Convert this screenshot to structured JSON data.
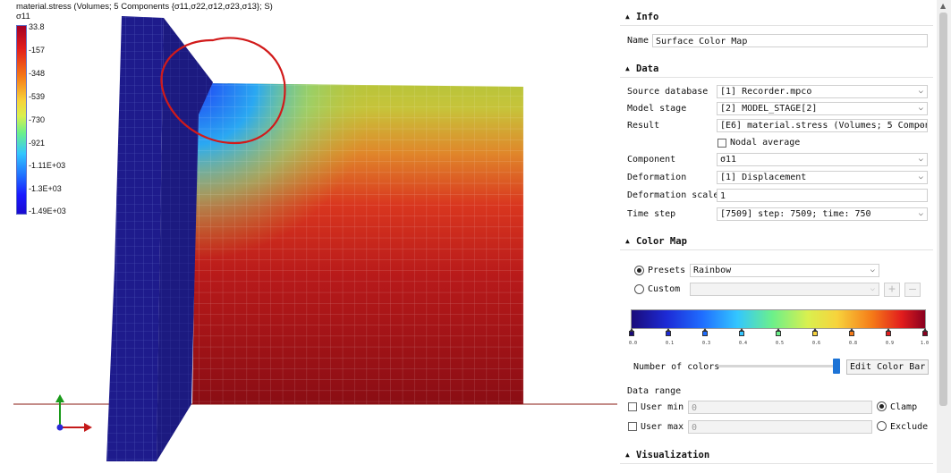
{
  "viewport": {
    "legend_title": "material.stress (Volumes; 5 Components {σ11,σ22,σ12,σ23,σ13}; S)",
    "legend_component": "σ11",
    "legend_ticks": [
      "33.8",
      "-157",
      "-348",
      "-539",
      "-730",
      "-921",
      "-1.11E+03",
      "-1.3E+03",
      "-1.49E+03"
    ]
  },
  "panel": {
    "info": {
      "header": "Info",
      "name_label": "Name",
      "name_value": "Surface Color Map"
    },
    "data": {
      "header": "Data",
      "source_database_label": "Source database",
      "source_database_value": "[1] Recorder.mpco",
      "model_stage_label": "Model stage",
      "model_stage_value": "[2] MODEL_STAGE[2]",
      "result_label": "Result",
      "result_value": "[E6] material.stress (Volumes; 5 Compon",
      "nodal_average_label": "Nodal average",
      "nodal_average_checked": false,
      "component_label": "Component",
      "component_value": "σ11",
      "deformation_label": "Deformation",
      "deformation_value": "[1] Displacement",
      "deformation_scale_label": "Deformation scale",
      "deformation_scale_value": "1",
      "time_step_label": "Time step",
      "time_step_value": "[7509] step: 7509; time: 750"
    },
    "color_map": {
      "header": "Color Map",
      "presets_label": "Presets",
      "presets_value": "Rainbow",
      "presets_selected": true,
      "custom_label": "Custom",
      "custom_value": "",
      "add_label": "+",
      "remove_label": "—",
      "stop_positions": [
        "0.0",
        "0.1",
        "0.3",
        "0.4",
        "0.5",
        "0.6",
        "0.8",
        "0.9",
        "1.0"
      ],
      "stop_colors": [
        "#1a0b7a",
        "#1d2bd6",
        "#1f6dff",
        "#33c6ff",
        "#6cf08a",
        "#f7d33c",
        "#f57a18",
        "#e21d1d",
        "#8a0020"
      ],
      "number_of_colors_label": "Number of colors",
      "edit_color_bar_label": "Edit Color Bar",
      "data_range_label": "Data range",
      "user_min_label": "User min",
      "user_min_value": "0",
      "user_max_label": "User max",
      "user_max_value": "0",
      "clamp_label": "Clamp",
      "clamp_selected": true,
      "exclude_label": "Exclude"
    },
    "visualization": {
      "header": "Visualization"
    }
  }
}
